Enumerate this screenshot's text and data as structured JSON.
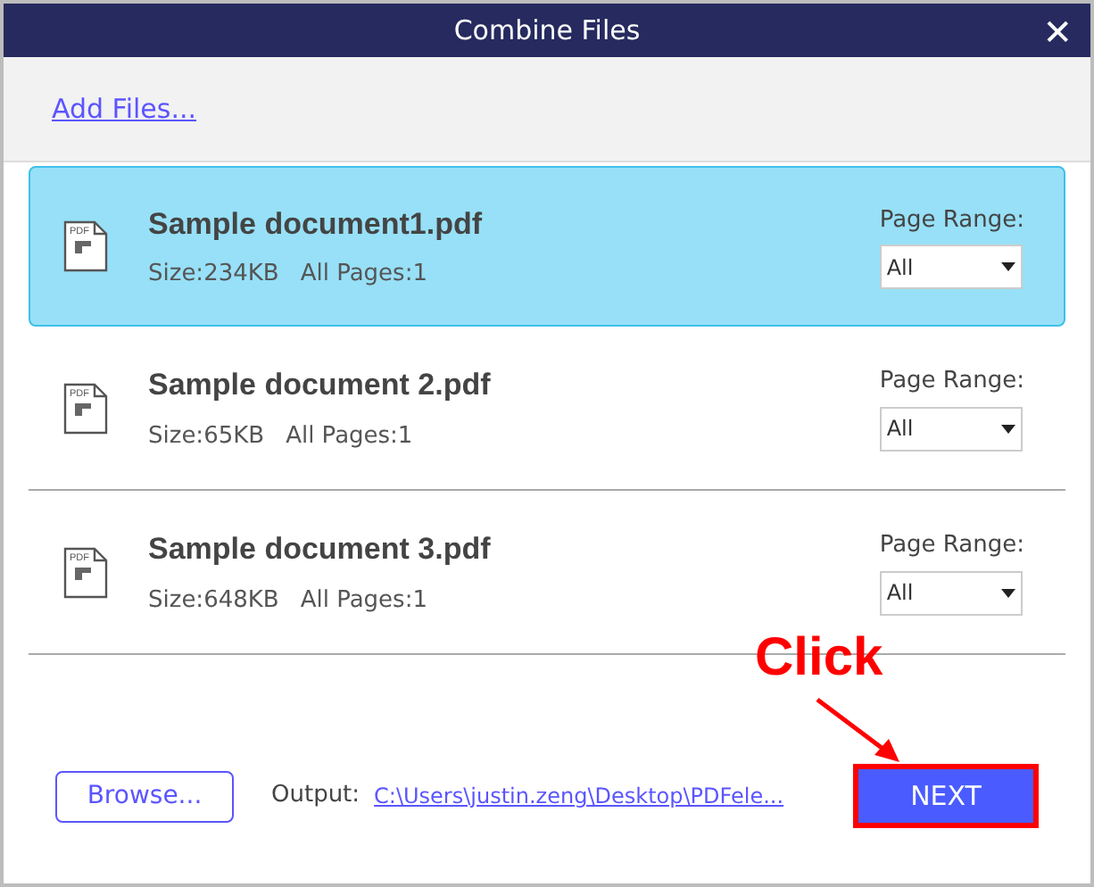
{
  "window": {
    "title": "Combine Files",
    "close": "✕"
  },
  "add_files": "Add Files...",
  "files": [
    {
      "icon_text": "PDF",
      "name": "Sample document1.pdf",
      "size": "Size:234KB",
      "pages": "All Pages:1",
      "range_label": "Page Range:",
      "range": "All",
      "selected": true
    },
    {
      "icon_text": "PDF",
      "name": "Sample document 2.pdf",
      "size": "Size:65KB",
      "pages": "All Pages:1",
      "range_label": "Page Range:",
      "range": "All",
      "selected": false
    },
    {
      "icon_text": "PDF",
      "name": "Sample document 3.pdf",
      "size": "Size:648KB",
      "pages": "All Pages:1",
      "range_label": "Page Range:",
      "range": "All",
      "selected": false
    }
  ],
  "footer": {
    "browse": "Browse...",
    "output_label": "Output:",
    "output_path": "C:\\Users\\justin.zeng\\Desktop\\PDFele...",
    "next": "NEXT"
  },
  "annotation": {
    "text": "Click"
  }
}
